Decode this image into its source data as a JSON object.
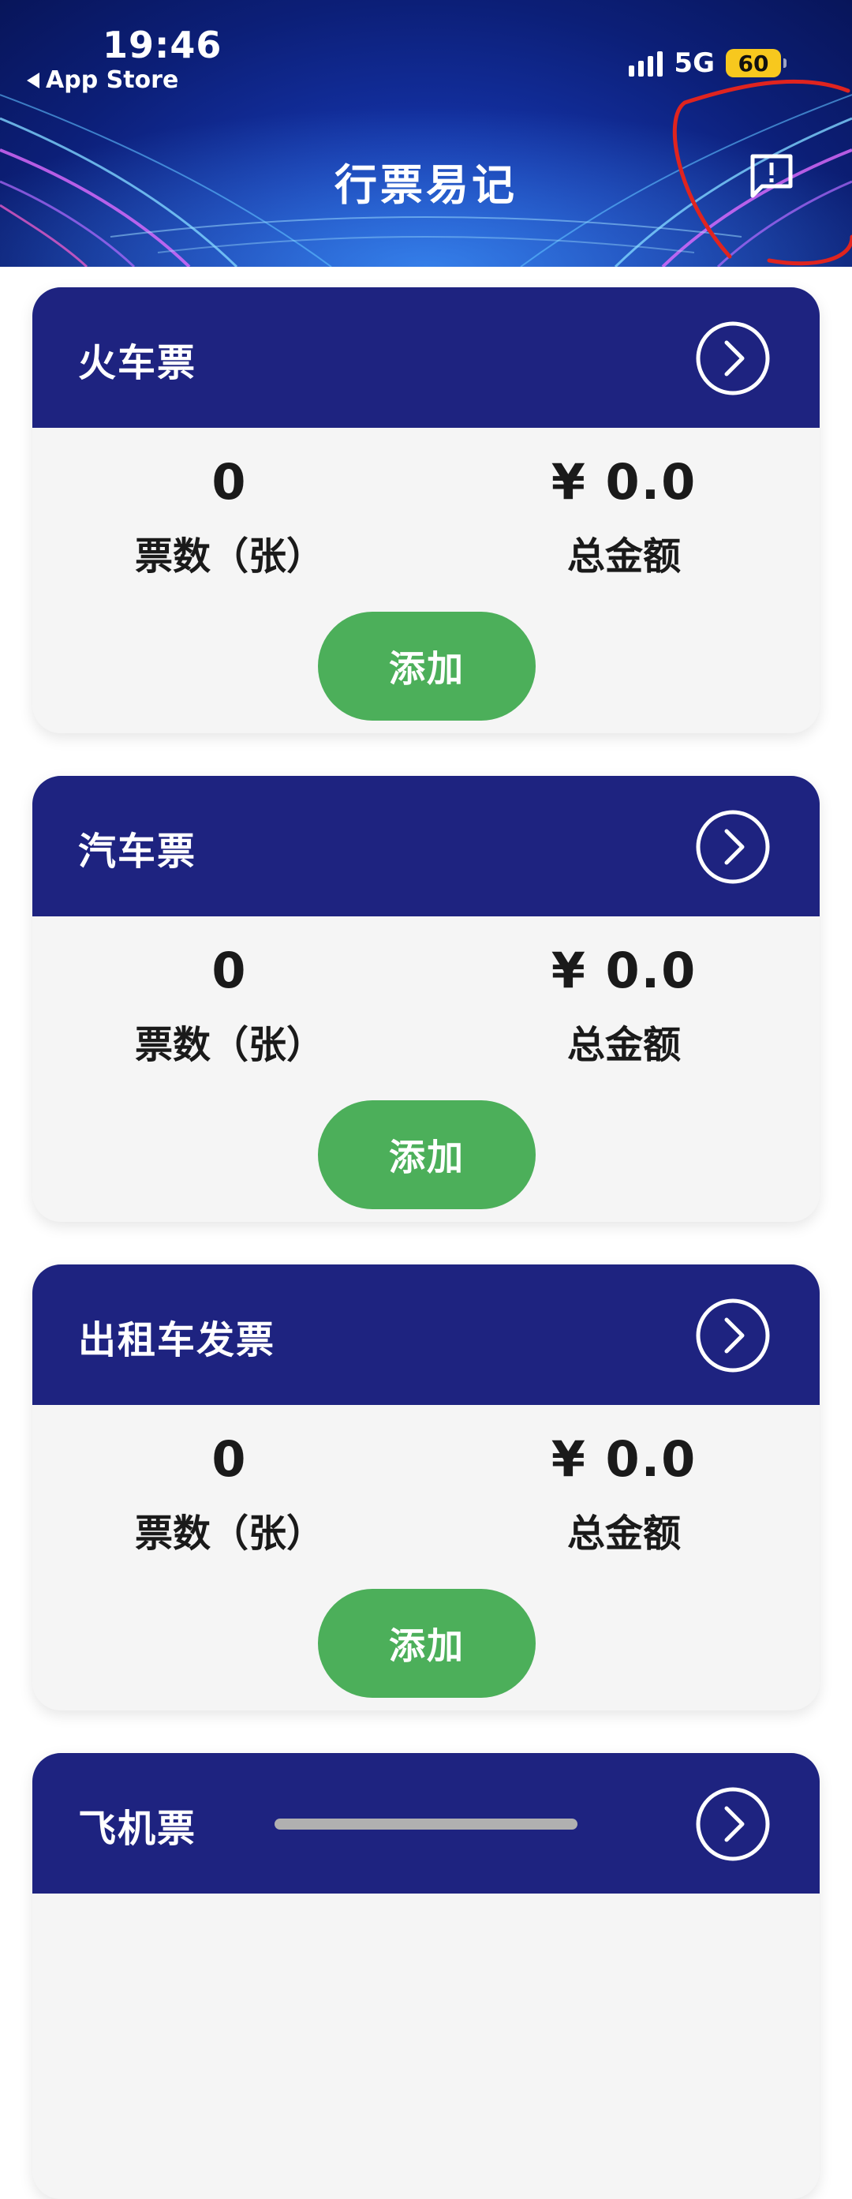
{
  "status_bar": {
    "time": "19:46",
    "back_label": "App Store",
    "network": "5G",
    "battery": "60"
  },
  "header": {
    "title": "行票易记",
    "feedback_icon": "message-alert-icon"
  },
  "cards": [
    {
      "title": "火车票",
      "count": "0",
      "count_label": "票数（张）",
      "amount": "¥ 0.0",
      "amount_label": "总金额",
      "add_label": "添加"
    },
    {
      "title": "汽车票",
      "count": "0",
      "count_label": "票数（张）",
      "amount": "¥ 0.0",
      "amount_label": "总金额",
      "add_label": "添加"
    },
    {
      "title": "出租车发票",
      "count": "0",
      "count_label": "票数（张）",
      "amount": "¥ 0.0",
      "amount_label": "总金额",
      "add_label": "添加"
    },
    {
      "title": "飞机票"
    }
  ],
  "colors": {
    "card_header": "#1e2380",
    "add_button": "#4caf5a",
    "card_body": "#f5f5f5",
    "annotation": "#e0241f"
  }
}
